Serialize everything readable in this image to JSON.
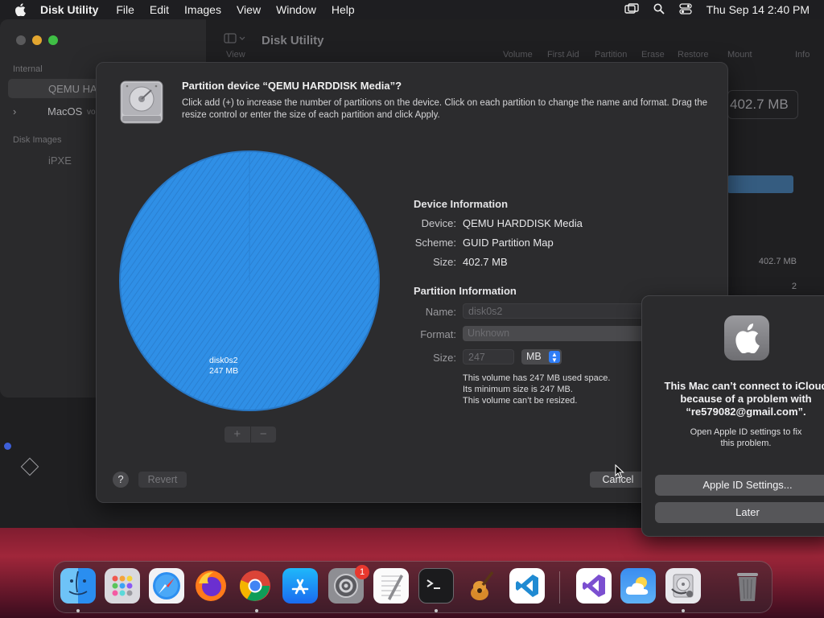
{
  "menubar": {
    "app_name": "Disk Utility",
    "items": [
      "File",
      "Edit",
      "Images",
      "View",
      "Window",
      "Help"
    ],
    "clock": "Thu Sep 14  2:40 PM"
  },
  "du_window": {
    "title": "Disk Utility",
    "view_label": "View",
    "sidebar": {
      "section_internal": "Internal",
      "item_qemu": "QEMU HA",
      "item_macos": "MacOS",
      "item_macos_suffix": "vo",
      "section_images": "Disk Images",
      "item_ipxe": "iPXE"
    },
    "toolbar": [
      "Volume",
      "First Aid",
      "Partition",
      "Erase",
      "Restore",
      "Mount",
      "Info"
    ],
    "right_size": "402.7 MB",
    "right_cell_size": "402.7 MB",
    "right_cell_count": "2"
  },
  "sheet": {
    "title": "Partition device “QEMU HARDDISK Media”?",
    "description": "Click add (+) to increase the number of partitions on the device. Click on each partition to change the name and format. Drag the resize control or enter the size of each partition and click Apply.",
    "pie": {
      "partition_name": "disk0s2",
      "partition_size": "247 MB",
      "add_label": "+",
      "remove_label": "−",
      "color": "#2f8fe6"
    },
    "device_info": {
      "heading": "Device Information",
      "device_label": "Device:",
      "device_value": "QEMU HARDDISK Media",
      "scheme_label": "Scheme:",
      "scheme_value": "GUID Partition Map",
      "size_label": "Size:",
      "size_value": "402.7 MB"
    },
    "partition_info": {
      "heading": "Partition Information",
      "name_label": "Name:",
      "name_value": "disk0s2",
      "format_label": "Format:",
      "format_value": "Unknown",
      "size_label": "Size:",
      "size_value": "247",
      "unit": "MB",
      "note_line1": "This volume has 247 MB used space.",
      "note_line2": "Its minimum size is 247 MB.",
      "note_line3": "This volume can’t be resized."
    },
    "buttons": {
      "help": "?",
      "revert": "Revert",
      "cancel": "Cancel"
    }
  },
  "alert": {
    "message_line1": "This Mac can’t connect to iCloud",
    "message_line2": "because of a problem with",
    "message_line3": "“re579082@gmail.com”.",
    "sub_line1": "Open Apple ID settings to fix",
    "sub_line2": "this problem.",
    "primary_button": "Apple ID Settings...",
    "secondary_button": "Later"
  },
  "dock": {
    "apps": [
      "Finder",
      "Launchpad",
      "Safari",
      "Firefox",
      "Chrome",
      "App Store",
      "System Settings",
      "TextEdit",
      "Terminal",
      "GarageBand",
      "Visual Studio Code",
      "Visual Studio",
      "Weather",
      "Disk Utility",
      "Trash"
    ],
    "settings_badge": "1"
  }
}
